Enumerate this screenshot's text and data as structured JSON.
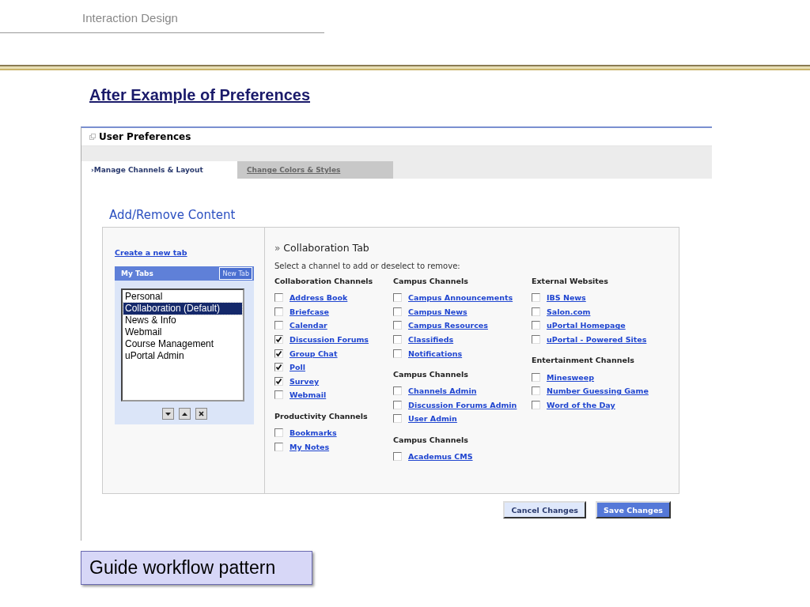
{
  "slide": {
    "header": "Interaction Design",
    "title": "After Example of Preferences",
    "caption": "Guide workflow pattern"
  },
  "portal": {
    "title": "User Preferences",
    "tabs": [
      {
        "label": "Manage Channels & Layout",
        "marker": "›",
        "selected": true
      },
      {
        "label": "Change Colors & Styles",
        "selected": false
      }
    ],
    "section_title": "Add/Remove Content",
    "create_tab_link": "Create a new tab",
    "my_tabs": {
      "title": "My Tabs",
      "new_tab_button": "New Tab",
      "items": [
        {
          "label": "Personal",
          "selected": false
        },
        {
          "label": "Collaboration (Default)",
          "selected": true
        },
        {
          "label": "News & Info",
          "selected": false
        },
        {
          "label": "Webmail",
          "selected": false
        },
        {
          "label": "Course Management",
          "selected": false
        },
        {
          "label": "uPortal Admin",
          "selected": false
        }
      ]
    },
    "tab_heading": {
      "marker": "»",
      "text": "Collaboration Tab"
    },
    "instruction": "Select a channel to add or deselect to remove:",
    "columns": [
      [
        {
          "title": "Collaboration Channels",
          "channels": [
            {
              "label": "Address Book",
              "checked": false
            },
            {
              "label": "Briefcase",
              "checked": false
            },
            {
              "label": "Calendar",
              "checked": false
            },
            {
              "label": "Discussion Forums",
              "checked": true
            },
            {
              "label": "Group Chat",
              "checked": true
            },
            {
              "label": "Poll",
              "checked": true
            },
            {
              "label": "Survey",
              "checked": true
            },
            {
              "label": "Webmail",
              "checked": false
            }
          ]
        },
        {
          "title": "Productivity Channels",
          "channels": [
            {
              "label": "Bookmarks",
              "checked": false
            },
            {
              "label": "My Notes",
              "checked": false
            }
          ]
        }
      ],
      [
        {
          "title": "Campus Channels",
          "channels": [
            {
              "label": "Campus Announcements",
              "checked": false
            },
            {
              "label": "Campus News",
              "checked": false
            },
            {
              "label": "Campus Resources",
              "checked": false
            },
            {
              "label": "Classifieds",
              "checked": false
            },
            {
              "label": "Notifications",
              "checked": false
            }
          ]
        },
        {
          "title": "Campus Channels",
          "channels": [
            {
              "label": "Channels Admin",
              "checked": false
            },
            {
              "label": "Discussion Forums Admin",
              "checked": false
            },
            {
              "label": "User Admin",
              "checked": false
            }
          ]
        },
        {
          "title": "Campus Channels",
          "channels": [
            {
              "label": "Academus CMS",
              "checked": false
            }
          ]
        }
      ],
      [
        {
          "title": "External Websites",
          "channels": [
            {
              "label": "IBS News",
              "checked": false
            },
            {
              "label": "Salon.com",
              "checked": false
            },
            {
              "label": "uPortal Homepage",
              "checked": false
            },
            {
              "label": "uPortal - Powered Sites",
              "checked": false
            }
          ]
        },
        {
          "title": "Entertainment Channels",
          "channels": [
            {
              "label": "Minesweep",
              "checked": false
            },
            {
              "label": "Number Guessing Game",
              "checked": false
            },
            {
              "label": "Word of the Day",
              "checked": false
            }
          ]
        }
      ]
    ],
    "buttons": [
      {
        "label": "Cancel Changes",
        "kind": "secondary"
      },
      {
        "label": "Save Changes",
        "kind": "primary"
      }
    ]
  }
}
